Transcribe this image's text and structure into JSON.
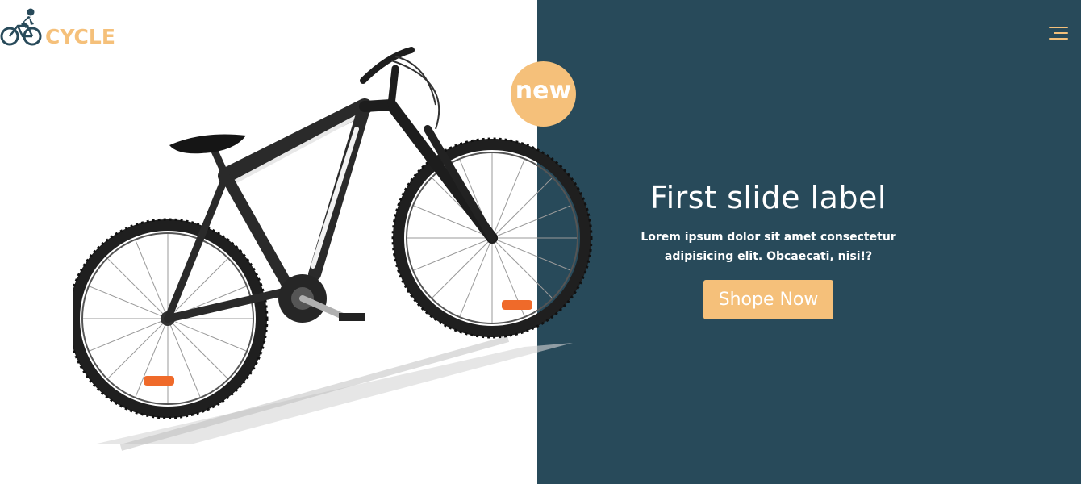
{
  "brand": {
    "logo_text": "CYCLE",
    "accent_color": "#f5c07a",
    "icon": "cyclist-logo-icon"
  },
  "nav": {
    "menu_icon": "menu-icon"
  },
  "badge": {
    "label": "new"
  },
  "slide": {
    "title": "First slide label",
    "description": "Lorem ipsum dolor sit amet consectetur adipisicing elit. Obcaecati, nisi!?",
    "button_label": "Shope Now",
    "image": "mountain-bike-image",
    "panel_color": "#284a5a"
  }
}
